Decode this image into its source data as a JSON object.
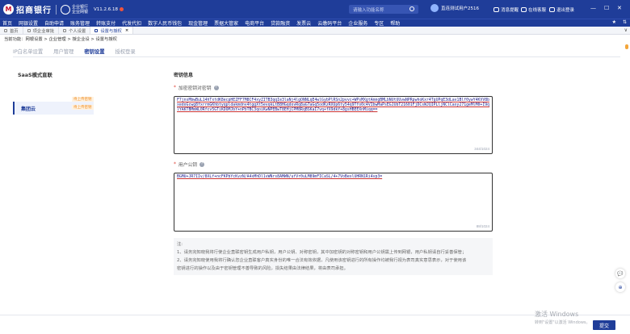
{
  "header": {
    "logo_mark": "M",
    "bank_name": "招商银行",
    "ebank_label": "企业银行",
    "ebank_sub": "企业网银",
    "version": "V11.2.6.18",
    "search_placeholder": "请输入功能名称",
    "user_name": "直连测试用户2516",
    "links": [
      "消息提醒",
      "在线客服",
      "退出登录"
    ],
    "window_controls": [
      "—",
      "☐",
      "✕"
    ]
  },
  "menu": {
    "items": [
      "首页",
      "网银设置",
      "自助申请",
      "账务管理",
      "转账支付",
      "代发代扣",
      "数字人民币钱包",
      "现金管理",
      "票据大管家",
      "电商平台",
      "贷款融资",
      "发票云",
      "云缴码平台",
      "企业服务",
      "专区",
      "帮助"
    ],
    "right_icons": [
      "★",
      "⇅"
    ]
  },
  "tabs": {
    "items": [
      {
        "label": "首页",
        "active": false
      },
      {
        "label": "项企业审批",
        "active": false
      },
      {
        "label": "个人设置",
        "active": false
      },
      {
        "label": "设置与授权",
        "active": true
      }
    ],
    "close_glyph": "×",
    "collapse_glyph": "∨"
  },
  "breadcrumb": "当前功能：网银设置 > 企业管理 > 授企业设 > 设置与授权",
  "subtabs": [
    "IP白名单设置",
    "用户管理",
    "密钥设置",
    "授权登录"
  ],
  "left": {
    "title": "SaaS模式直联",
    "item_label": "集团云",
    "badge1": "待上传密钥",
    "badge2": "待上传密钥"
  },
  "right": {
    "section_title": "密钥信息",
    "field1_label": "加密密钥对密钥",
    "field1_value": "F7jnsMbwBuL14hTxtdK8ecpHEZFF7M8CF4xyZITB3qqIe3laNj4lgONNLqE4wlGybPlRSn2pvvc+WPsMXgtAmngBMLbNUtUUvwNPRpwhoKxr4TgUPqE3dLav1Blf0ywY4KVV8bxedoGcwg8fxrrmGKhbtyqpldakmdnv4tggXt5evqkLtB8HGqdovRq8aGTaGq5odKzRXUp6ty54q9Tfo0c4VIbwMaPsEGJUbT21601FjDCsWJQIPLljNClCaxy271geMlM0+I9qlYAKTBMmWL0Rfcv5GTiKDOMJbY+nPbTBC3qoiKwNPEBwT8EHjCPM8RqBSKaI7vq+fX9dkY+8gsHBEEXnMiqq==",
    "field1_count": "344/1024",
    "field2_label": "用户公钥",
    "field2_value": "BGMU+JR7IIv/8XLf+ncFKPbYcKvzN/A4xMhDl1vWNrs8AMWN/ufVr0uLM89mFICaSL/4+7VoBexlUHRN1Ri4vp3=",
    "field2_count": "88/1024",
    "notes_title": "注:",
    "notes": [
      "1、请务完知晓我将行使企业直联密钥生成用户私钥，用户公钥、对称密钥，其中加密钥的对称密钥和用户公钥需上传到网银，用户私钥请自行妥善保管；",
      "2、请务完知晓使用我将行确认您企业直联客户真实身份的唯一合法有效依据，凡使用该密钥进行的所有操作均被我行视为表司真实意思表示，对于使用该",
      "密钥进行的操作以及由于密钥管理不善导致的风险，损失结果由法律结果，将由表司承担。"
    ]
  },
  "floating": [
    "💬",
    "⊕"
  ],
  "footer": {
    "watermark_line1": "激活 Windows",
    "watermark_line2": "转到\"设置\"以激活 Windows。",
    "submit_label": "提交"
  }
}
